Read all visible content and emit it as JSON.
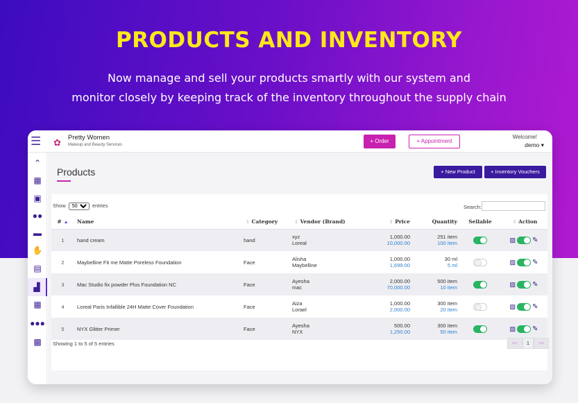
{
  "hero": {
    "title": "PRODUCTS AND INVENTORY",
    "subtitle_line1": "Now manage and sell your products smartly with our system and",
    "subtitle_line2": "monitor closely by keeping track of the inventory throughout the supply chain"
  },
  "topbar": {
    "brand_name": "Pretty Women",
    "brand_tagline": "Makeup and Beauty Services",
    "order_label": "+ Order",
    "appointment_label": "+ Appointment",
    "welcome": "Welcome!",
    "user": "demo ▾"
  },
  "sidebar": {
    "icons": [
      "chevrons-up-icon",
      "boxes-icon",
      "calendar-check-icon",
      "users-icon",
      "credit-card-icon",
      "handshake-icon",
      "clipboard-icon",
      "warehouse-icon",
      "grid-icon",
      "user-group-icon",
      "calculator-icon"
    ]
  },
  "page": {
    "title": "Products",
    "new_product_label": "+ New Product",
    "vouchers_label": "+ Inventory Vouchers"
  },
  "table": {
    "show_label": "Show",
    "entries_label": "entries",
    "page_size": "50",
    "search_label": "Search:",
    "headers": [
      "#",
      "Name",
      "Category",
      "Vendor (Brand)",
      "Price",
      "Quantity",
      "Sellable",
      "Action"
    ],
    "rows": [
      {
        "n": "1",
        "name": "hand cream",
        "category": "hand",
        "vendor": "xyz",
        "brand": "Loreal",
        "price": "1,000.00",
        "price2": "10,000.00",
        "qty": "251 item",
        "qty2": "100 item",
        "sellable": true
      },
      {
        "n": "2",
        "name": "Maybelline Fit me Matte Poreless Foundation",
        "category": "Face",
        "vendor": "Alisha",
        "brand": "Maybelline",
        "price": "1,000.00",
        "price2": "1,699.00",
        "qty": "30 ml",
        "qty2": "5 ml",
        "sellable": false
      },
      {
        "n": "3",
        "name": "Mac Studio fix powder Plus Foundation NC",
        "category": "Face",
        "vendor": "Ayesha",
        "brand": "mac",
        "price": "2,000.00",
        "price2": "70,000.00",
        "qty": "500 item",
        "qty2": "10 item",
        "sellable": true
      },
      {
        "n": "4",
        "name": "Loreal Paris Infallible 24H Matte Cover Foundation",
        "category": "Face",
        "vendor": "Aiza",
        "brand": "Lorael",
        "price": "1,000.00",
        "price2": "2,000.00",
        "qty": "300 item",
        "qty2": "20 item",
        "sellable": false
      },
      {
        "n": "5",
        "name": "NYX Glitter Primer",
        "category": "Face",
        "vendor": "Ayesha",
        "brand": "NYX",
        "price": "500.00",
        "price2": "1,250.00",
        "qty": "300 item",
        "qty2": "50 item",
        "sellable": true
      }
    ],
    "footer": "Showing 1 to 5 of 5 entries",
    "pager_prev": "<<",
    "pager_page": "1",
    "pager_next": ">>"
  },
  "colors": {
    "accent": "#c821b0",
    "primary": "#3a1a9e",
    "toggle_on": "#28b463",
    "link": "#2d7fd0"
  }
}
